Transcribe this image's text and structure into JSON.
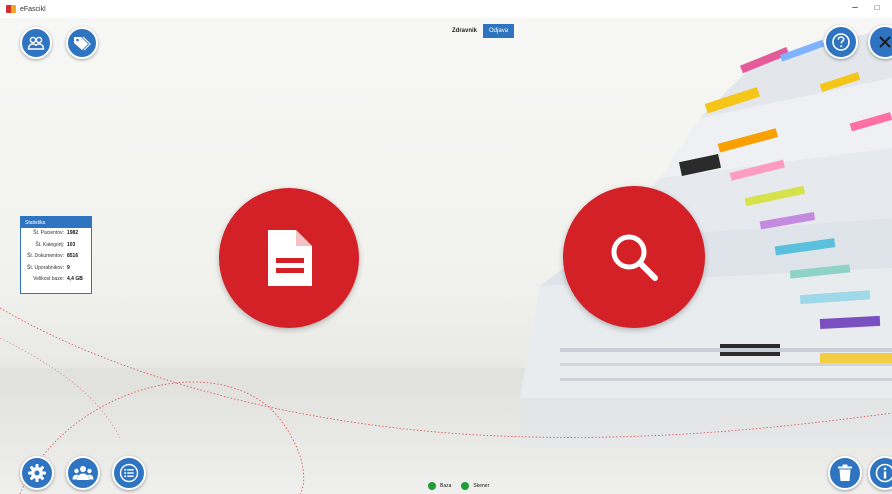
{
  "window": {
    "title": "eFascikl",
    "minimize_glyph": "–",
    "maximize_glyph": "□"
  },
  "header": {
    "user_name": "Zdravnik",
    "logout_label": "Odjava"
  },
  "statistics": {
    "title": "Statistika",
    "rows": [
      {
        "label": "Št. Pacientov:",
        "value": "1982"
      },
      {
        "label": "Št. Kategorij:",
        "value": "103"
      },
      {
        "label": "Št. Dokumentov:",
        "value": "8516"
      },
      {
        "label": "Št. Uporabnikov:",
        "value": "9"
      },
      {
        "label": "Velikost baze:",
        "value": "4,4 GB"
      }
    ]
  },
  "status": {
    "items": [
      {
        "label": "Baza",
        "color": "#1f9d3a"
      },
      {
        "label": "Skener",
        "color": "#1f9d3a"
      }
    ]
  },
  "icons": {
    "top_left": [
      "patients-icon",
      "tags-icon"
    ],
    "top_right": [
      "help-icon",
      "close-icon"
    ],
    "center": [
      "document-icon",
      "search-icon"
    ],
    "bottom_left": [
      "settings-icon",
      "users-icon",
      "list-icon"
    ],
    "bottom_right": [
      "trash-icon",
      "info-icon"
    ]
  },
  "colors": {
    "accent_blue": "#2f74c0",
    "accent_red": "#d42027",
    "status_green": "#1f9d3a"
  }
}
